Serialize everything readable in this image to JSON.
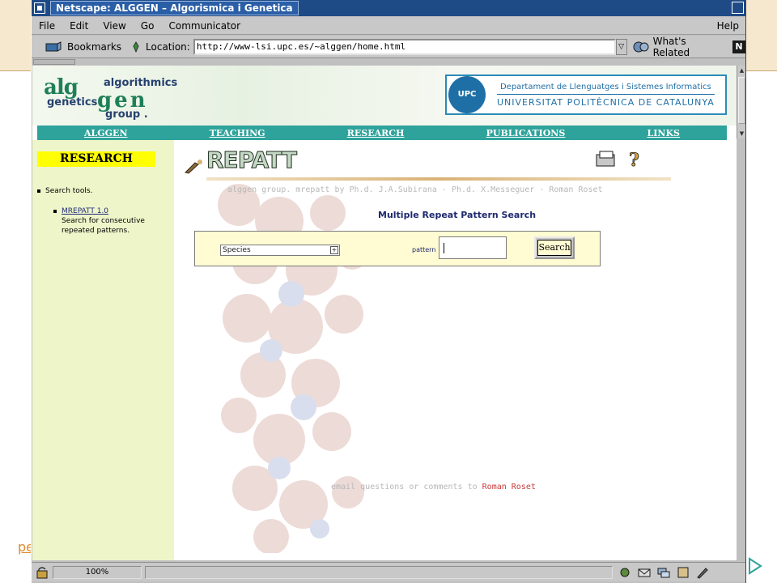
{
  "slide": {
    "edge_link": "pe"
  },
  "window": {
    "title": "Netscape: ALGGEN – Algorismica i Genetica"
  },
  "menu": {
    "items": [
      "File",
      "Edit",
      "View",
      "Go",
      "Communicator"
    ],
    "help": "Help"
  },
  "toolbar": {
    "bookmarks": "Bookmarks",
    "location_label": "Location:",
    "url": "http://www-lsi.upc.es/~alggen/home.html",
    "related": "What's Related"
  },
  "banner": {
    "logo_letters_top": "alg",
    "logo_letters_mid": "gen",
    "logo_word_1": "algorithmics",
    "logo_word_2": "genetics",
    "logo_word_3": "group .",
    "upc_seal": "UPC",
    "upc_dept": "Departament de Llenguatges i Sistemes Informatics",
    "upc_name": "UNIVERSITAT POLITÈCNICA DE CATALUNYA"
  },
  "nav": [
    "ALGGEN",
    "TEACHING",
    "RESEARCH",
    "PUBLICATIONS",
    "LINKS"
  ],
  "sidebar": {
    "title": "RESEARCH",
    "item": "Search tools.",
    "subitem_link": "MREPATT 1.0",
    "subitem_text": "Search for consecutive repeated patterns."
  },
  "main": {
    "title": "REPATT",
    "credits": "alggen group. mrepatt by Ph.d. J.A.Subirana - Ph.d. X.Messeguer - Roman Roset",
    "subtitle": "Multiple Repeat Pattern Search",
    "species_value": "Species",
    "pattern_label": "pattern",
    "pattern_value": "",
    "search_button": "Search",
    "footer_text": "email questions or comments to",
    "footer_name": "Roman Roset"
  },
  "status": {
    "zoom": "100%"
  },
  "colors": {
    "nav_bar": "#2ea39b",
    "sidebar_bg": "#eef5c9",
    "highlight": "#ffff00",
    "titlebar": "#1e4b86"
  }
}
